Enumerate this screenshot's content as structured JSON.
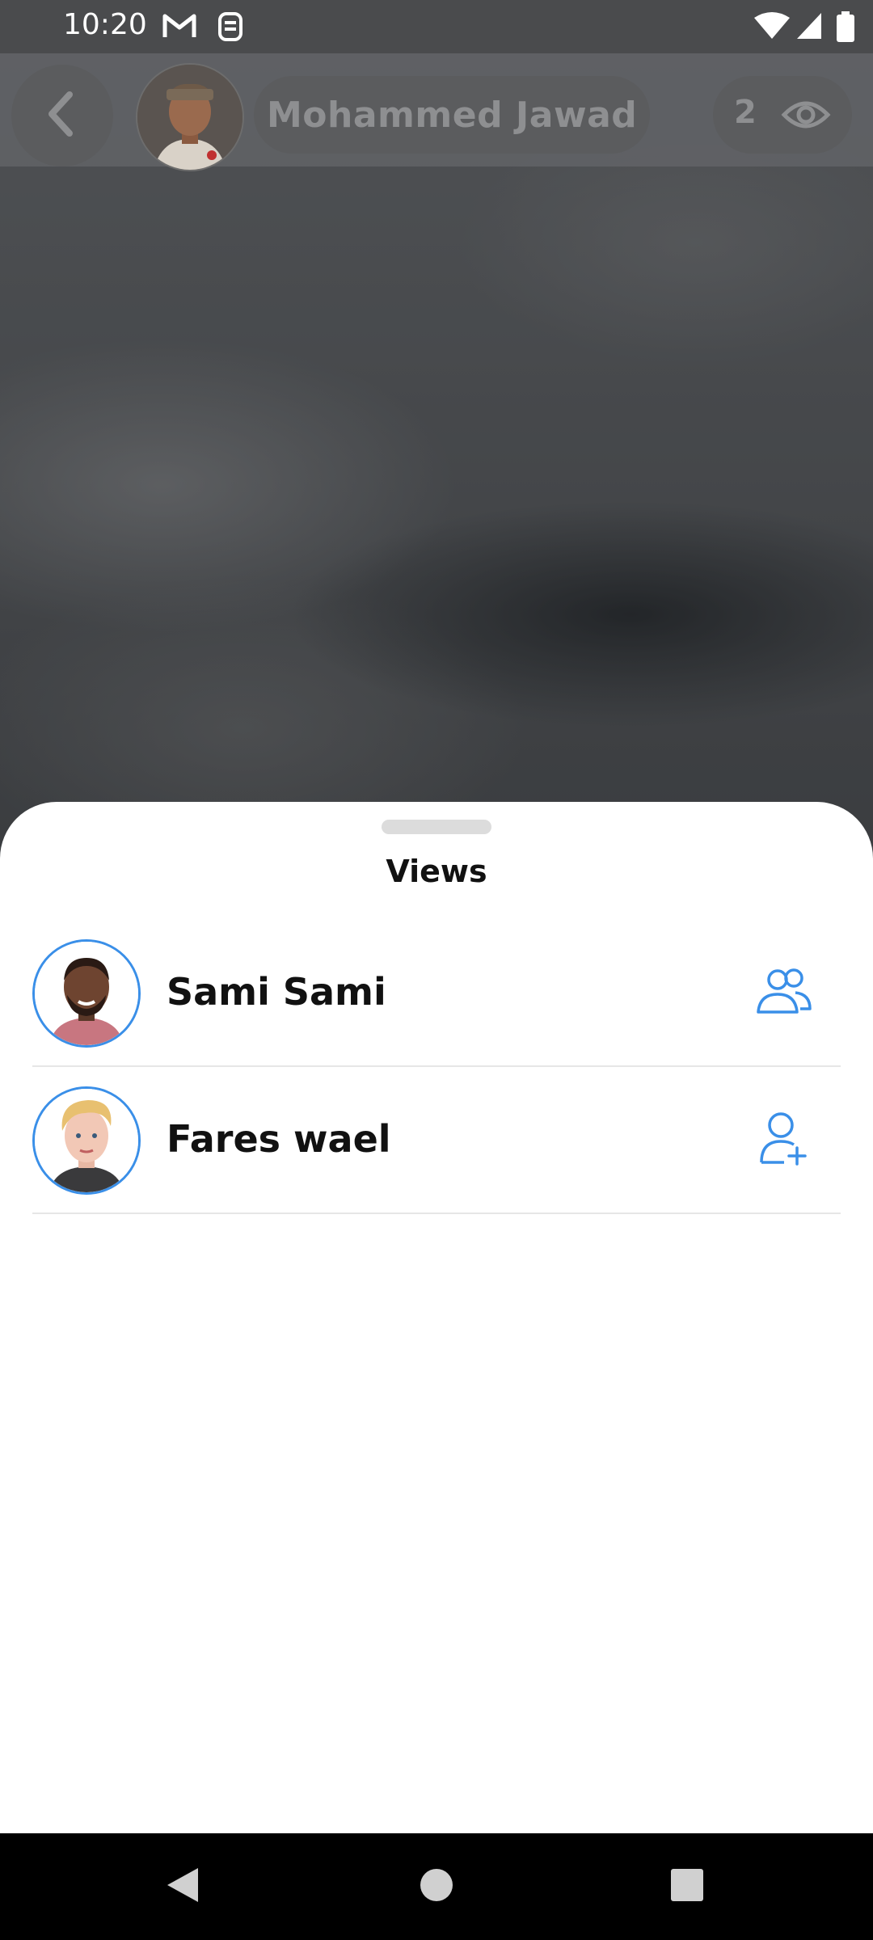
{
  "status_bar": {
    "time": "10:20",
    "icons": [
      "gmail-icon",
      "sim-icon",
      "wifi-icon",
      "signal-icon",
      "battery-icon"
    ]
  },
  "header": {
    "poster_name": "Mohammed Jawad",
    "views_count": "2",
    "icons": [
      "back-arrow-icon",
      "eye-icon"
    ]
  },
  "sheet": {
    "title": "Views",
    "viewers": [
      {
        "name": "Sami Sami",
        "action_icon": "friends-icon"
      },
      {
        "name": "Fares wael",
        "action_icon": "add-friend-icon"
      }
    ]
  },
  "nav_bar": {
    "icons": [
      "nav-back-icon",
      "nav-home-icon",
      "nav-recents-icon"
    ]
  },
  "colors": {
    "accent": "#3a8fe8",
    "sheet_bg": "#ffffff",
    "status_bar_bg": "#4a4b4d"
  }
}
